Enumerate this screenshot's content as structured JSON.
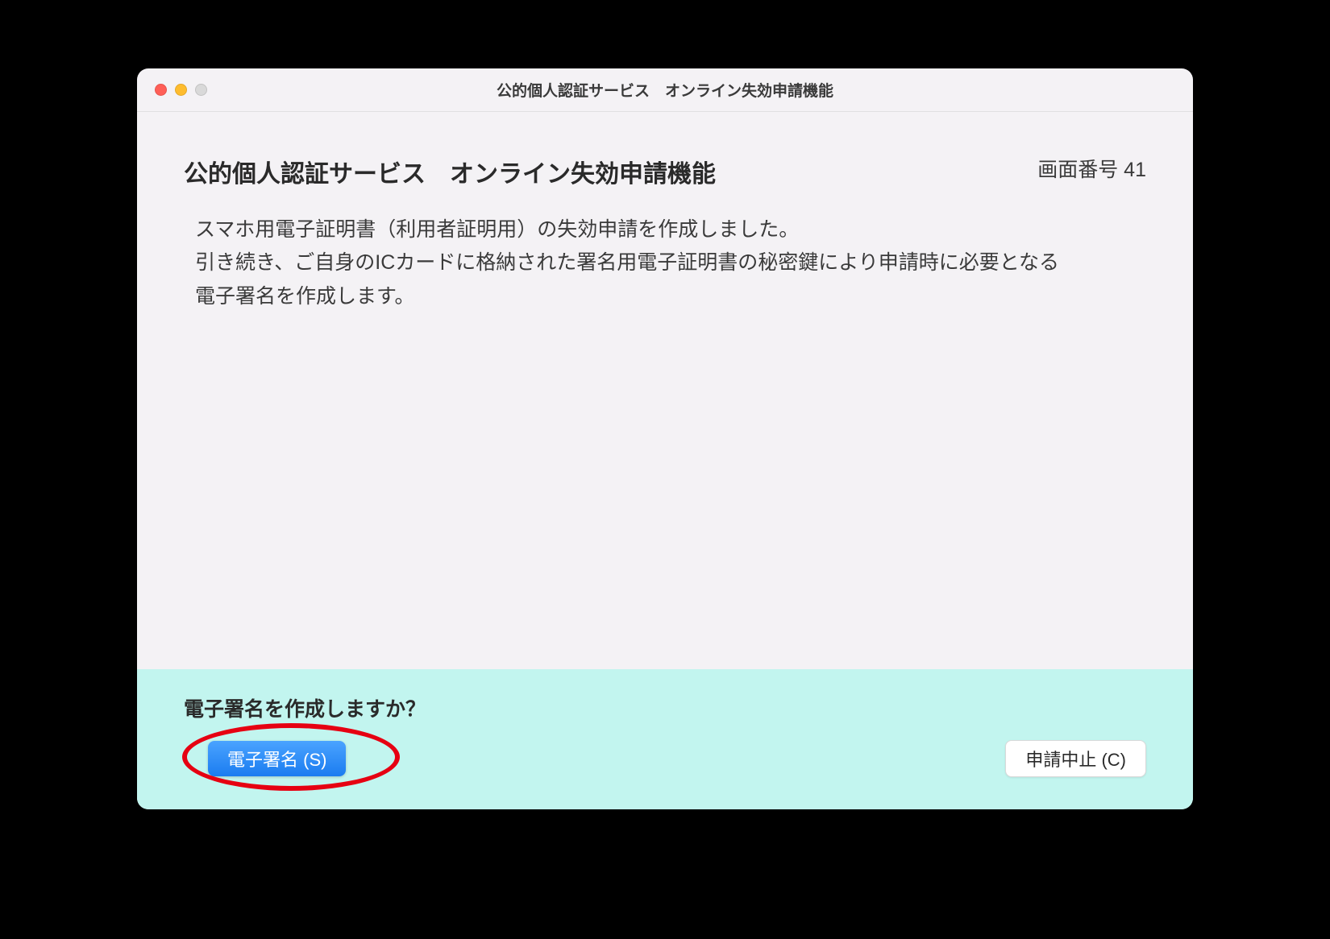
{
  "titlebar": {
    "title": "公的個人認証サービス　オンライン失効申請機能"
  },
  "screen": {
    "number_label": "画面番号 41",
    "heading": "公的個人認証サービス　オンライン失効申請機能",
    "body_line1": "スマホ用電子証明書（利用者証明用）の失効申請を作成しました。",
    "body_line2": "引き続き、ご自身のICカードに格納された署名用電子証明書の秘密鍵により申請時に必要となる電子署名を作成します。"
  },
  "footer": {
    "prompt": "電子署名を作成しますか？",
    "sign_button": "電子署名 (S)",
    "cancel_button": "申請中止 (C)"
  }
}
